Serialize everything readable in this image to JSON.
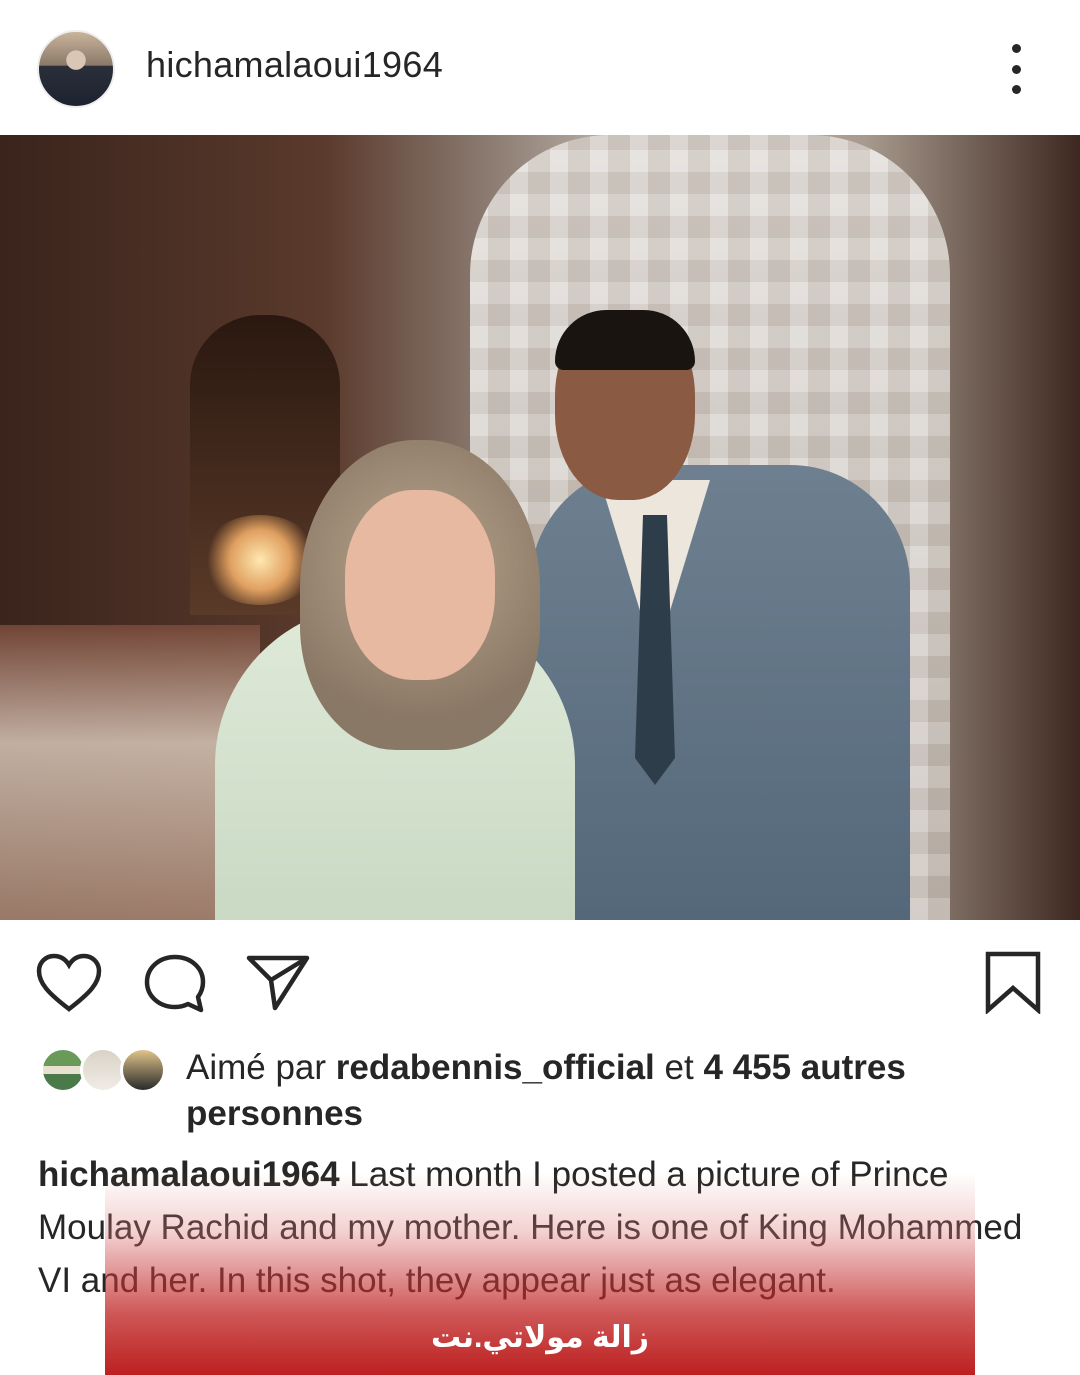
{
  "post": {
    "username": "hichamalaoui1964"
  },
  "likes": {
    "prefix": "Aimé par",
    "top_liker": "redabennis_official",
    "conjunction": "et",
    "count_text": "4 455 autres personnes"
  },
  "caption": {
    "username": "hichamalaoui1964",
    "text": "Last month I posted a picture of Prince Moulay Rachid and my mother. Here is one of King Mohammed VI and her. In this shot, they appear just as elegant."
  },
  "watermark": {
    "text": "زالة مولاتي.نت"
  },
  "icons": [
    "avatar",
    "more-icon",
    "heart-icon",
    "comment-icon",
    "share-icon",
    "bookmark-icon"
  ],
  "colors": {
    "text": "#262626",
    "watermark": "#b91414"
  }
}
